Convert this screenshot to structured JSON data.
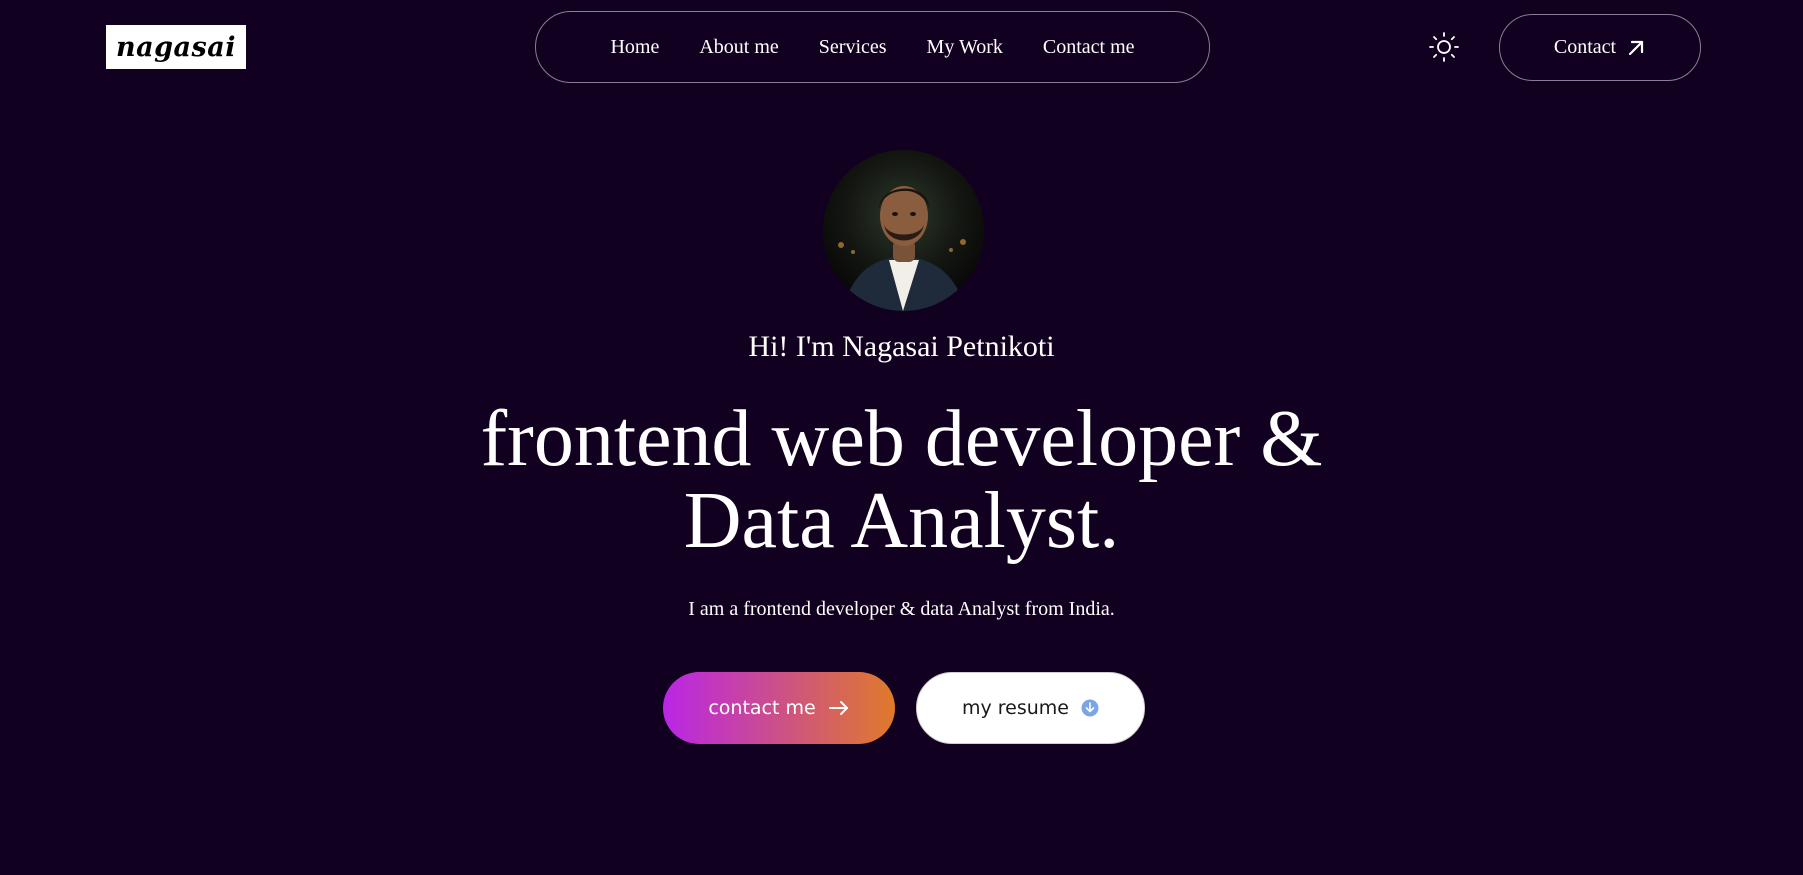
{
  "header": {
    "logo_text": "nagasai",
    "nav": [
      {
        "label": "Home"
      },
      {
        "label": "About me"
      },
      {
        "label": "Services"
      },
      {
        "label": "My Work"
      },
      {
        "label": "Contact me"
      }
    ],
    "theme_toggle_icon": "sun-icon",
    "contact_label": "Contact",
    "contact_icon": "arrow-up-right-icon"
  },
  "hero": {
    "avatar_icon": "profile-photo",
    "greeting": "Hi! I'm Nagasai Petnikoti",
    "headline_line1": "frontend web developer &",
    "headline_line2": "Data Analyst.",
    "subline": "I am a frontend developer & data Analyst from India.",
    "primary_button": {
      "label": "contact me",
      "icon": "arrow-right-icon"
    },
    "secondary_button": {
      "label": "my resume",
      "icon": "download-icon"
    }
  },
  "colors": {
    "background": "#11001f",
    "gradient_start": "#b926e6",
    "gradient_end": "#e07a2a",
    "border": "#8a7d97",
    "download_icon": "#7aa6e8"
  }
}
